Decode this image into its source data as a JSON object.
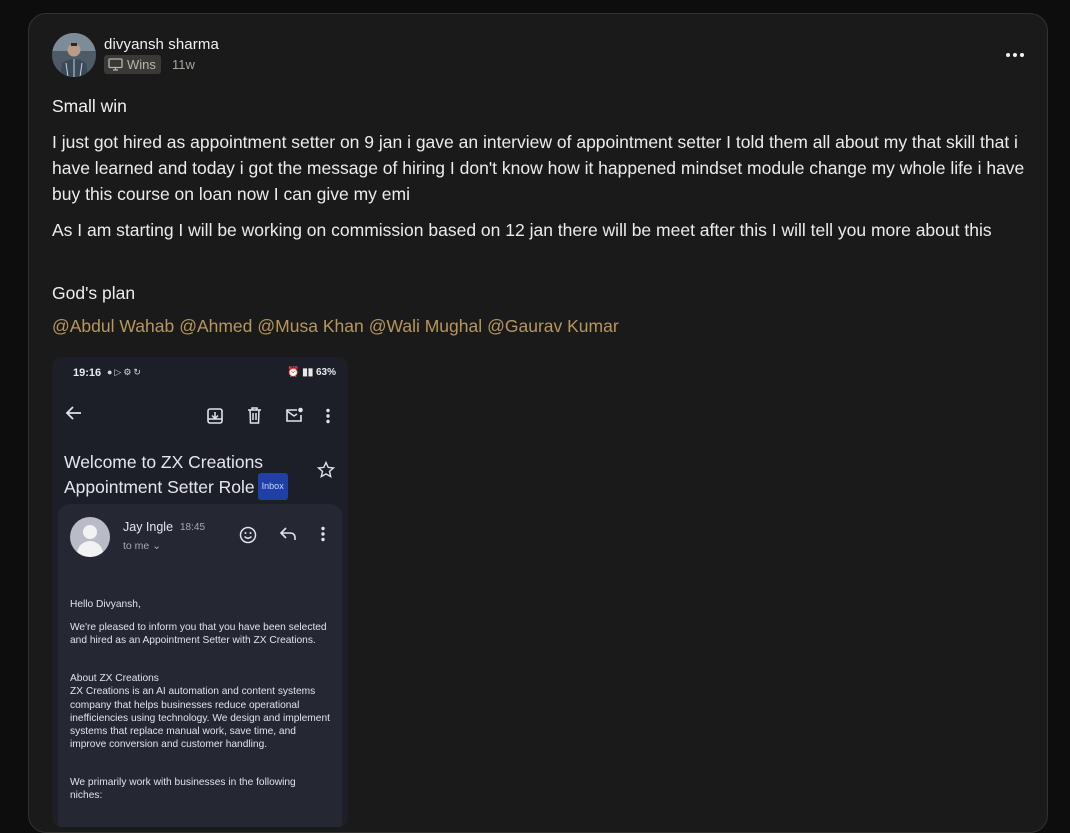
{
  "post": {
    "author": "divyansh sharma",
    "category": "Wins",
    "age": "11w",
    "title": "Small win",
    "paragraphs": [
      "I just got hired as appointment setter on 9 jan i gave an interview of appointment setter I told them all about my that skill that i have learned and today i got the message of hiring I don't know how it happened mindset module change my whole life i have buy this course on loan now I can give my emi",
      "As I am starting I will be working on commission based on 12 jan there will be meet after this I will tell you more about this",
      "God's plan"
    ],
    "mentions": [
      "@Abdul Wahab",
      "@Ahmed",
      "@Musa Khan",
      "@Wali Mughal",
      "@Gaurav Kumar"
    ]
  },
  "screenshot": {
    "status_time": "19:16",
    "status_right": "63%",
    "subject": "Welcome to ZX Creations Appointment Setter Role",
    "label": "Inbox",
    "sender": "Jay Ingle",
    "sent_time": "18:45",
    "recipient": "to me",
    "greeting": "Hello Divyansh,",
    "para1": "We're pleased to inform you that you have been selected and hired as an Appointment Setter with ZX Creations.",
    "about_heading": "About ZX Creations",
    "about_body": "ZX Creations is an AI automation and content systems company that helps businesses reduce operational inefficiencies using technology. We design and implement systems that replace manual work, save time, and improve conversion and customer handling.",
    "para3": "We primarily work with businesses in the following niches:"
  },
  "colors": {
    "mention": "#b8965d",
    "card_bg": "#1a1a1a",
    "inbox_badge": "#2140a6"
  }
}
